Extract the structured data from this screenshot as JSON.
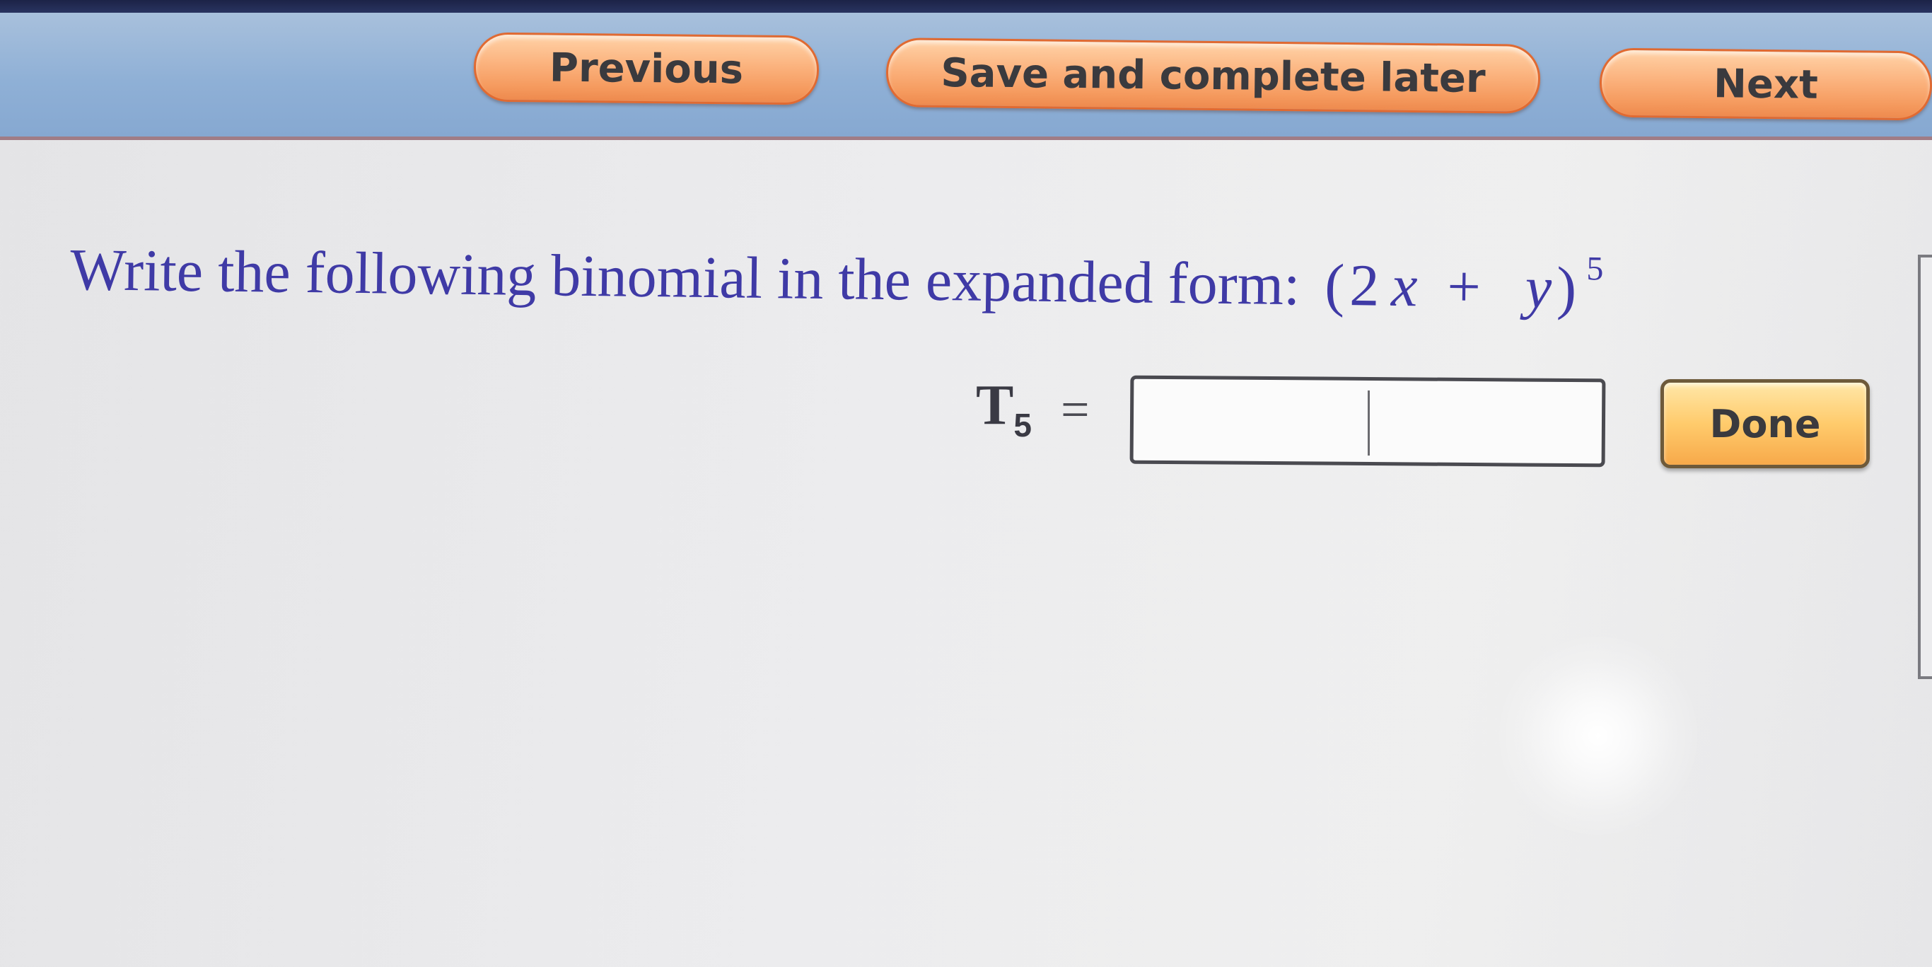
{
  "nav": {
    "previous_label": "Previous",
    "save_label": "Save and complete later",
    "next_label": "Next"
  },
  "question": {
    "prompt": "Write the following binomial in the expanded form:",
    "open_paren": "(",
    "coefficient": "2",
    "var_x": "x",
    "plus": "+",
    "var_y": "y",
    "close_paren": ")",
    "exponent": "5"
  },
  "answer": {
    "term_label": "T",
    "term_index": "5",
    "equals": "=",
    "input_value": "",
    "done_label": "Done"
  },
  "colors": {
    "question_text": "#3f3aa6",
    "nav_button_fill": "#f59a5e",
    "nav_bar": "#8fb0d6",
    "done_button_fill": "#ffcb6c"
  }
}
